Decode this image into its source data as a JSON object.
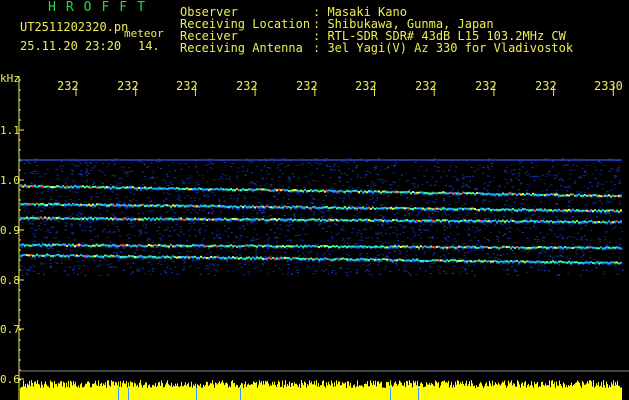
{
  "header": {
    "app_title": "HROFFT",
    "filename": "UT2511202320.pn",
    "meteor_tag": "meteor",
    "datetime": "25.11.20 23:20",
    "count": "14.",
    "observer_label": "Observer",
    "observer_value": ": Masaki Kano",
    "location_label": "Receiving Location",
    "location_value": ": Shibukawa, Gunma, Japan",
    "receiver_label": "Receiver",
    "receiver_value": ": RTL-SDR SDR# 43dB L15 103.2MHz CW",
    "antenna_label": "Receiving Antenna",
    "antenna_value": ": 3el Yagi(V) Az 330 for Vladivostok"
  },
  "axis": {
    "unit": "kHz",
    "y_ticks": [
      "1.1",
      "1.0",
      "0.9",
      "0.8",
      "0.7",
      "0.6"
    ],
    "x_ticks": [
      "232",
      "232",
      "232",
      "232",
      "232",
      "232",
      "232",
      "232",
      "232",
      "2330"
    ]
  },
  "colors": {
    "text": "#eeee55",
    "title": "#22dd33",
    "background": "#000000",
    "noise_bar": "#ffff00"
  }
}
